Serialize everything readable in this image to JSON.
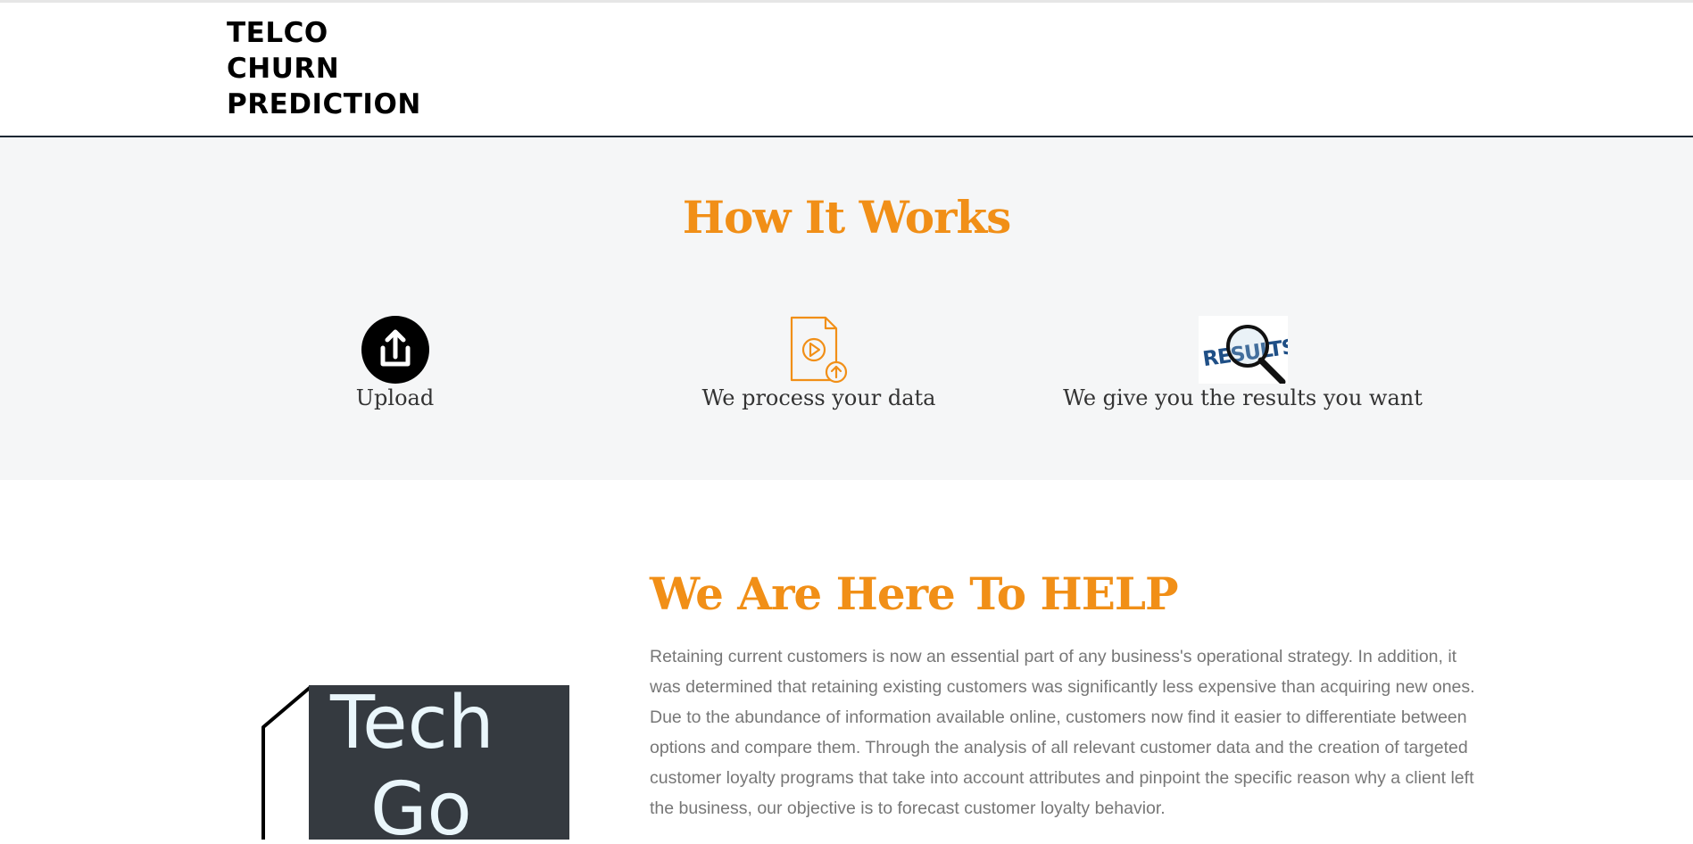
{
  "header": {
    "brand_lines": [
      "TELCO",
      "CHURN",
      "PREDICTION"
    ]
  },
  "how_it_works": {
    "title": "How It Works",
    "steps": [
      {
        "label": "Upload",
        "icon": "upload-icon"
      },
      {
        "label": "We process your data",
        "icon": "file-process-icon"
      },
      {
        "label": "We give you the results you want",
        "icon": "results-magnifier-icon"
      }
    ],
    "results_icon_text": "RESULTS"
  },
  "help": {
    "title": "We Are Here To HELP",
    "body": "Retaining current customers is now an essential part of any business's operational strategy. In addition, it was determined that retaining existing customers was significantly less expensive than acquiring new ones. Due to the abundance of information available online, customers now find it easier to differentiate between options and compare them. Through the analysis of all relevant customer data and the creation of targeted customer loyalty programs that take into account attributes and pinpoint the specific reason why a client left the business, our objective is to forecast customer loyalty behavior."
  },
  "logo": {
    "line1": "Tech",
    "line2": "Go"
  },
  "colors": {
    "accent": "#f18f17",
    "section_bg": "#f5f6f7",
    "body_text": "#777777",
    "logo_bg": "#353a40",
    "logo_text": "#eaf6fb"
  }
}
